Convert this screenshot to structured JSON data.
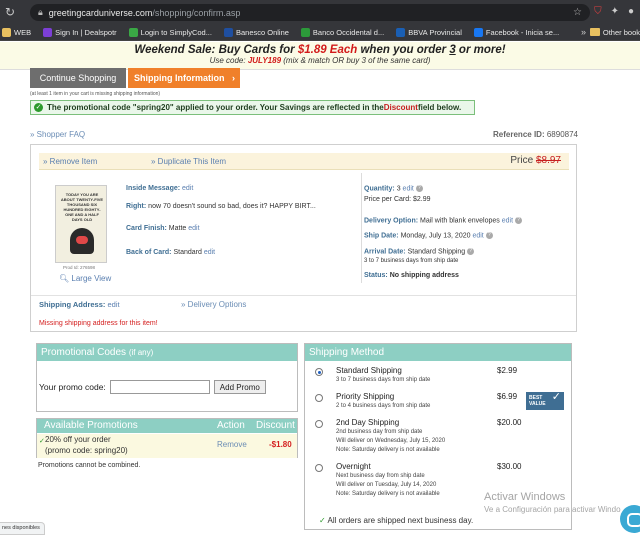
{
  "browser": {
    "url_host": "greetingcarduniverse.com",
    "url_path": "/shopping/confirm.asp",
    "bookmarks": [
      {
        "label": "WEB",
        "icon": "folder-icon",
        "color": "#e8c060"
      },
      {
        "label": "Sign In | Dealspotr",
        "icon": "dealspotr-icon",
        "color": "#7c3fd6"
      },
      {
        "label": "Login to SimplyCod...",
        "icon": "simplycoding-icon",
        "color": "#3aa845"
      },
      {
        "label": "Banesco Online",
        "icon": "banesco-icon",
        "color": "#1f4fa0"
      },
      {
        "label": "Banco Occidental d...",
        "icon": "bod-icon",
        "color": "#2c9a3a"
      },
      {
        "label": "BBVA Provincial",
        "icon": "bbva-icon",
        "color": "#1a5fb4"
      },
      {
        "label": "Facebook - Inicia se...",
        "icon": "facebook-icon",
        "color": "#1877f2"
      }
    ],
    "more": "»",
    "other_bookmarks": "Other book"
  },
  "sale": {
    "line1_prefix": "Weekend Sale: Buy Cards for ",
    "line1_price": "$1.89 Each",
    "line1_mid": " when you order ",
    "line1_qty": "3",
    "line1_suffix": " or more!",
    "line2_prefix": "Use code: ",
    "line2_code": "JULY189",
    "line2_suffix": " (mix & match OR buy 3 of the same card)"
  },
  "steps": {
    "continue_label": "Continue Shopping",
    "shipping_label": "Shipping Information",
    "shipping_arrow": "›",
    "notice": "(at least 1 item in your cart is missing shipping information)"
  },
  "promo_applied": {
    "prefix": "The promotional code \"spring20\" applied to your order. Your Savings are reflected in the ",
    "highlight": "Discount",
    "suffix": " field below."
  },
  "faq_label": "» Shopper FAQ",
  "reference": {
    "label": "Reference ID:",
    "value": "6890874"
  },
  "cart": {
    "remove_item": "» Remove Item",
    "duplicate_item": "» Duplicate This Item",
    "price_label": "Price",
    "price_value": "$8.97",
    "card_text": "TODAY YOU ARE ABOUT TWENTY-FIVE THOUSAND SIX HUNDRED EIGHTY-ONE AND A HALF DAYS OLD",
    "prod_id": "Prod Id: 276598",
    "large_view": "Large View",
    "inside_label": "Inside Message:",
    "right_label": "Right:",
    "right_value": "now 70 doesn't sound so bad, does it? HAPPY BIRT...",
    "finish_label": "Card Finish:",
    "finish_value": "Matte",
    "back_label": "Back of Card:",
    "back_value": "Standard",
    "edit": "edit",
    "quantity_label": "Quantity:",
    "quantity_value": "3",
    "price_per_card": "Price per Card: $2.99",
    "delivery_label": "Delivery Option:",
    "delivery_value": "Mail with blank envelopes",
    "ship_date_label": "Ship Date:",
    "ship_date_value": "Monday, July 13, 2020",
    "arrival_label": "Arrival Date:",
    "arrival_value": "Standard Shipping",
    "arrival_sub": "3 to 7 business days from ship date",
    "status_label": "Status:",
    "status_value": "No shipping address",
    "ship_addr_label": "Shipping Address:",
    "delivery_options": "» Delivery Options",
    "missing": "Missing shipping address for this item!"
  },
  "promo_codes": {
    "title": "Promotional Codes",
    "title_suffix": "(if any)",
    "field_label": "Your promo code:",
    "field_value": "",
    "button": "Add Promo"
  },
  "available_promotions": {
    "title": "Available Promotions",
    "col_action": "Action",
    "col_discount": "Discount",
    "check": "✓",
    "name": "20% off your order",
    "code": "(promo code: spring20)",
    "action": "Remove",
    "discount": "-$1.80",
    "note": "Promotions cannot be combined."
  },
  "shipping_method": {
    "title": "Shipping Method",
    "options": [
      {
        "name": "Standard Shipping",
        "lines": [
          "3 to 7 business days from ship date"
        ],
        "price": "$2.99",
        "selected": true
      },
      {
        "name": "Priority Shipping",
        "lines": [
          "2 to 4 business days from ship date"
        ],
        "price": "$6.99",
        "selected": false
      },
      {
        "name": "2nd Day Shipping",
        "lines": [
          "2nd business day from ship date",
          "Will deliver on Wednesday, July 15, 2020",
          "Note: Saturday delivery is not available"
        ],
        "price": "$20.00",
        "selected": false
      },
      {
        "name": "Overnight",
        "lines": [
          "Next business day from ship date",
          "Will deliver on Tuesday, July 14, 2020",
          "Note: Saturday delivery is not available"
        ],
        "price": "$30.00",
        "selected": false
      }
    ],
    "best_value_line1": "BEST",
    "best_value_line2": "VALUE",
    "all_orders": "All orders are shipped next business day."
  },
  "overlay": {
    "activate_title": "Activar Windows",
    "activate_sub": "Ve a Configuración para activar Windo",
    "status_pill": "nes disponibles"
  },
  "colors": {
    "teal": "#8dcfc3",
    "orange": "#f0802a",
    "red": "#d42020",
    "link": "#5a7fb0"
  }
}
